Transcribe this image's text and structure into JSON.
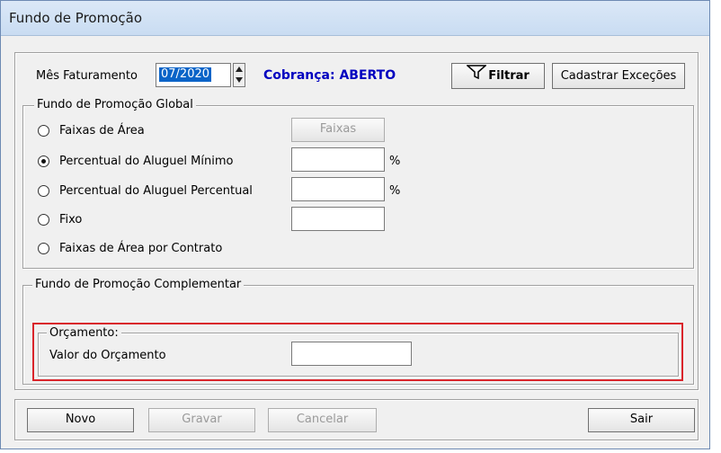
{
  "window": {
    "title": "Fundo de Promoção"
  },
  "header": {
    "mes_label": "Mês Faturamento",
    "mes_value": "07/2020",
    "cobranca_label": "Cobrança: ABERTO",
    "cobranca_color": "#0000c0",
    "filtrar_label": "Filtrar",
    "cadastrar_label": "Cadastrar Exceções"
  },
  "global": {
    "title": "Fundo de Promoção Global",
    "faixas_button": "Faixas",
    "options": [
      {
        "label": "Faixas de Área",
        "selected": false
      },
      {
        "label": "Percentual do Aluguel Mínimo",
        "selected": true
      },
      {
        "label": "Percentual do Aluguel Percentual",
        "selected": false
      },
      {
        "label": "Fixo",
        "selected": false
      },
      {
        "label": "Faixas de Área por Contrato",
        "selected": false
      }
    ],
    "pct_symbol": "%"
  },
  "complementar": {
    "title": "Fundo de Promoção Complementar",
    "orcamento_title": "Orçamento:",
    "valor_label": "Valor do Orçamento",
    "valor_value": "",
    "highlight_color": "#d9242b"
  },
  "footer": {
    "novo": "Novo",
    "gravar": "Gravar",
    "cancelar": "Cancelar",
    "sair": "Sair"
  }
}
